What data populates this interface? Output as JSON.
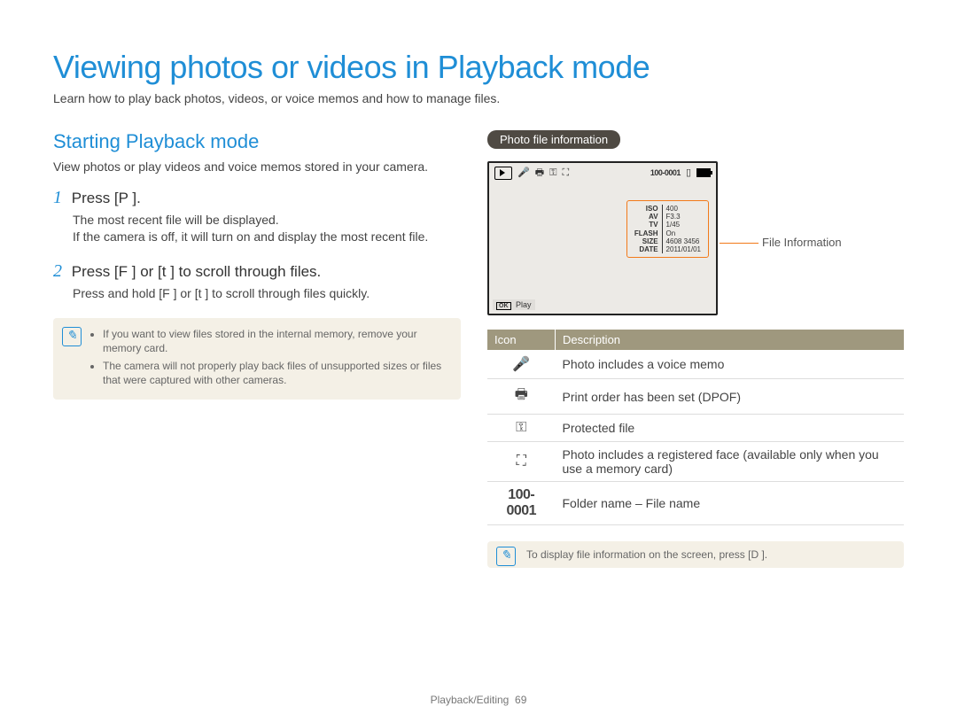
{
  "title": "Viewing photos or videos in Playback mode",
  "subtitle": "Learn how to play back photos, videos, or voice memos and how to manage files.",
  "left": {
    "heading": "Starting Playback mode",
    "desc": "View photos or play videos and voice memos stored in your camera.",
    "steps": [
      {
        "num": "1",
        "line": "Press [P   ].",
        "details": [
          "The most recent file will be displayed.",
          "If the camera is off, it will turn on and display the most recent file."
        ]
      },
      {
        "num": "2",
        "line": "Press [F   ] or [t    ] to scroll through files.",
        "details": [
          "Press and hold [F   ] or [t    ] to scroll through files quickly."
        ]
      }
    ],
    "note": {
      "items": [
        "If you want to view files stored in the internal memory, remove your memory card.",
        "The camera will not properly play back files of unsupported sizes or files that were captured with other cameras."
      ]
    }
  },
  "right": {
    "pill": "Photo file information",
    "lcd": {
      "folder_file": "100-0001",
      "info": {
        "ISO": "400",
        "AV": "F3.3",
        "TV": "1/45",
        "FLASH": "On",
        "SIZE": "4608  3456",
        "DATE": "2011/01/01"
      },
      "ok_label": "OK",
      "play_label": "Play",
      "callout": "File Information"
    },
    "table": {
      "headers": [
        "Icon",
        "Description"
      ],
      "rows": [
        {
          "icon": "🎤",
          "desc": "Photo includes a voice memo"
        },
        {
          "icon": "🖶",
          "desc": "Print order has been set (DPOF)"
        },
        {
          "icon": "⚿",
          "desc": "Protected file"
        },
        {
          "icon": "⛶",
          "desc": "Photo includes a registered face (available only when you use a memory card)"
        },
        {
          "icon": "100-0001",
          "desc": "Folder name – File name",
          "is_text": true
        }
      ]
    },
    "note": "To display file information on the screen, press [D       ]."
  },
  "footer": {
    "section": "Playback/Editing",
    "page": "69"
  }
}
